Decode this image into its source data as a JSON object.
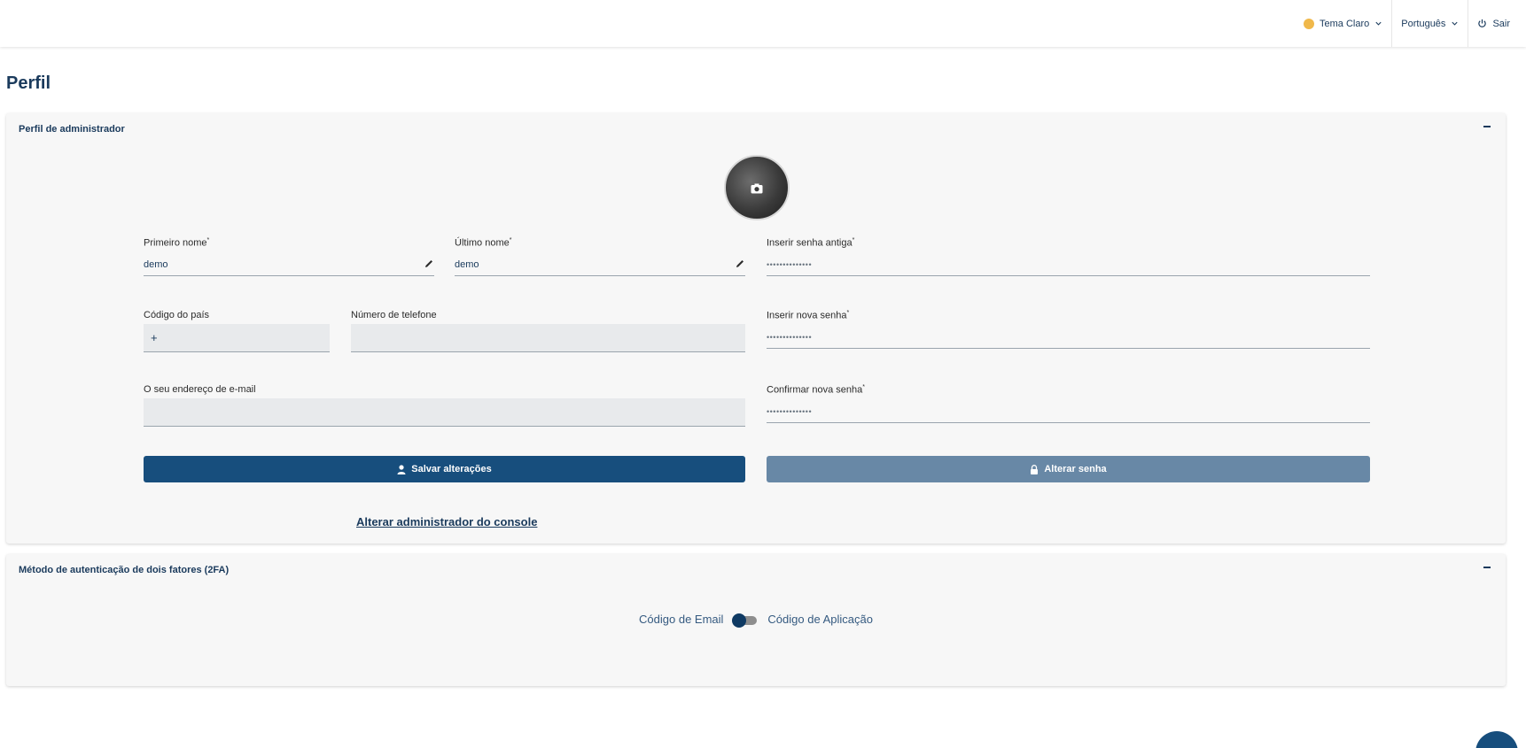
{
  "header": {
    "theme_label": "Tema Claro",
    "language_label": "Português",
    "logout_label": "Sair",
    "theme_color": "#f0b84a"
  },
  "page": {
    "title": "Perfil"
  },
  "admin_panel": {
    "title": "Perfil de administrador",
    "first_name": {
      "label": "Primeiro nome",
      "value": "demo"
    },
    "last_name": {
      "label": "Último nome",
      "value": "demo"
    },
    "old_password": {
      "label": "Inserir senha antiga",
      "value": "••••••••••••••"
    },
    "country_code": {
      "label": "Código do país",
      "value": "+"
    },
    "phone": {
      "label": "Número de telefone",
      "value": ""
    },
    "new_password": {
      "label": "Inserir nova senha",
      "value": "••••••••••••••"
    },
    "email": {
      "label": "O seu endereço de e-mail",
      "value": ""
    },
    "confirm_password": {
      "label": "Confirmar nova senha",
      "value": "••••••••••••••"
    },
    "save_button": "Salvar alterações",
    "change_password_button": "Alterar senha",
    "change_admin_link": "Alterar administrador do console",
    "required_mark": "*"
  },
  "twofa_panel": {
    "title": "Método de autenticação de dois fatores (2FA)",
    "left_option": "Código de Email",
    "right_option": "Código de Aplicação"
  },
  "colors": {
    "primary": "#174e7d",
    "primary_disabled": "#6888a6",
    "panel_bg": "#f7f7f7"
  }
}
